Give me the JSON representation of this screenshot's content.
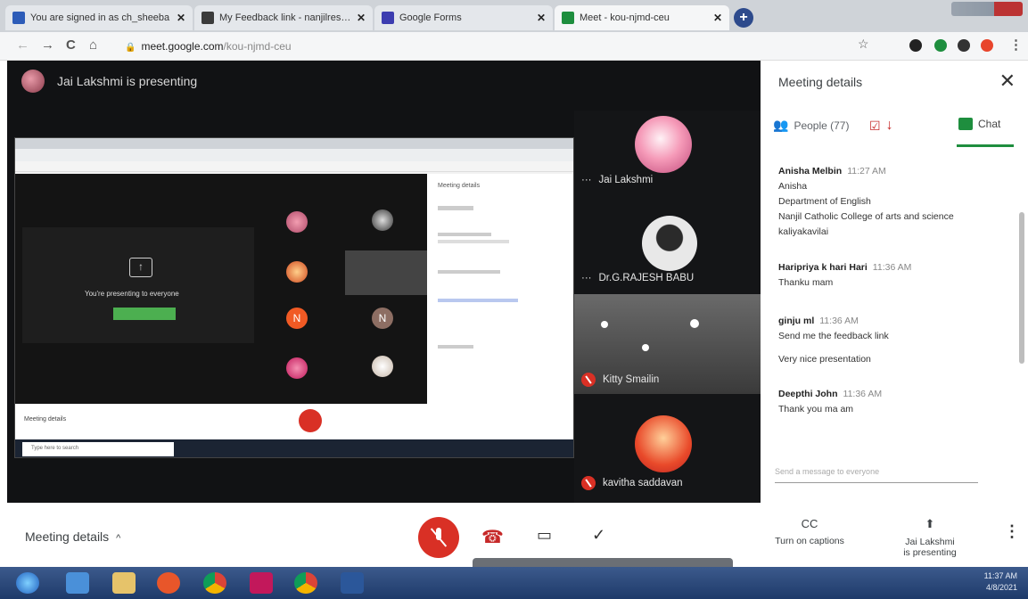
{
  "browser": {
    "tabs": [
      {
        "label": "You are signed in as ch_sheeba",
        "color": "#2d5cb8"
      },
      {
        "label": "My Feedback link - nanjilresearchc",
        "color": "#3b3b3b"
      },
      {
        "label": "Google Forms",
        "color": "#3d3db0"
      },
      {
        "label": "Meet - kou-njmd-ceu",
        "color": "#1e8e3e"
      }
    ],
    "new_tab": "+",
    "close_glyph": "✕",
    "url_host": "meet.google.com",
    "url_path": "/kou-njmd-ceu",
    "nav": {
      "back": "←",
      "forward": "→",
      "reload": "C",
      "home": "⌂"
    },
    "star": "☆"
  },
  "meet": {
    "presenting_banner": "Jai Lakshmi is presenting",
    "shared_screen": {
      "panel_title": "Meeting details",
      "present_text": "You're presenting to everyone",
      "meeting_details": "Meeting details",
      "search": "Type here to search",
      "letter_n": "N"
    },
    "participants": [
      {
        "name": "Jai Lakshmi",
        "muted": false
      },
      {
        "name": "Dr.G.RAJESH BABU",
        "muted": false
      },
      {
        "name": "Kitty Smailin",
        "muted": true
      },
      {
        "name": "kavitha saddavan",
        "muted": true
      }
    ],
    "more_glyph": "···",
    "panel": {
      "title": "Meeting details",
      "close": "✕",
      "tab_people": "People (77)",
      "tab_chat": "Chat",
      "messages": [
        {
          "sender": "Anisha Melbin",
          "time": "11:27 AM",
          "lines": [
            "Anisha",
            "Department of English",
            "Nanjil Catholic College of arts and science",
            "kaliyakavilai"
          ]
        },
        {
          "sender": "Haripriya k hari Hari",
          "time": "11:36 AM",
          "lines": [
            "Thanku mam"
          ]
        },
        {
          "sender": "ginju ml",
          "time": "11:36 AM",
          "lines": [
            "Send me the feedback link",
            "Very nice presentation"
          ]
        },
        {
          "sender": "Deepthi John",
          "time": "11:36 AM",
          "lines": [
            "Thank you ma am"
          ]
        }
      ],
      "send_placeholder": "Send a message to everyone"
    },
    "bottom": {
      "meeting_details": "Meeting details",
      "chevron": "^",
      "captions_label": "Turn on captions",
      "captions_icon": "CC",
      "presenting_line1": "Jai Lakshmi",
      "presenting_line2": "is presenting",
      "more": "⋮"
    }
  },
  "taskbar": {
    "time": "11:37 AM",
    "date": "4/8/2021"
  },
  "colors": {
    "accent_green": "#1e8e3e",
    "hangup_red": "#d93025"
  }
}
